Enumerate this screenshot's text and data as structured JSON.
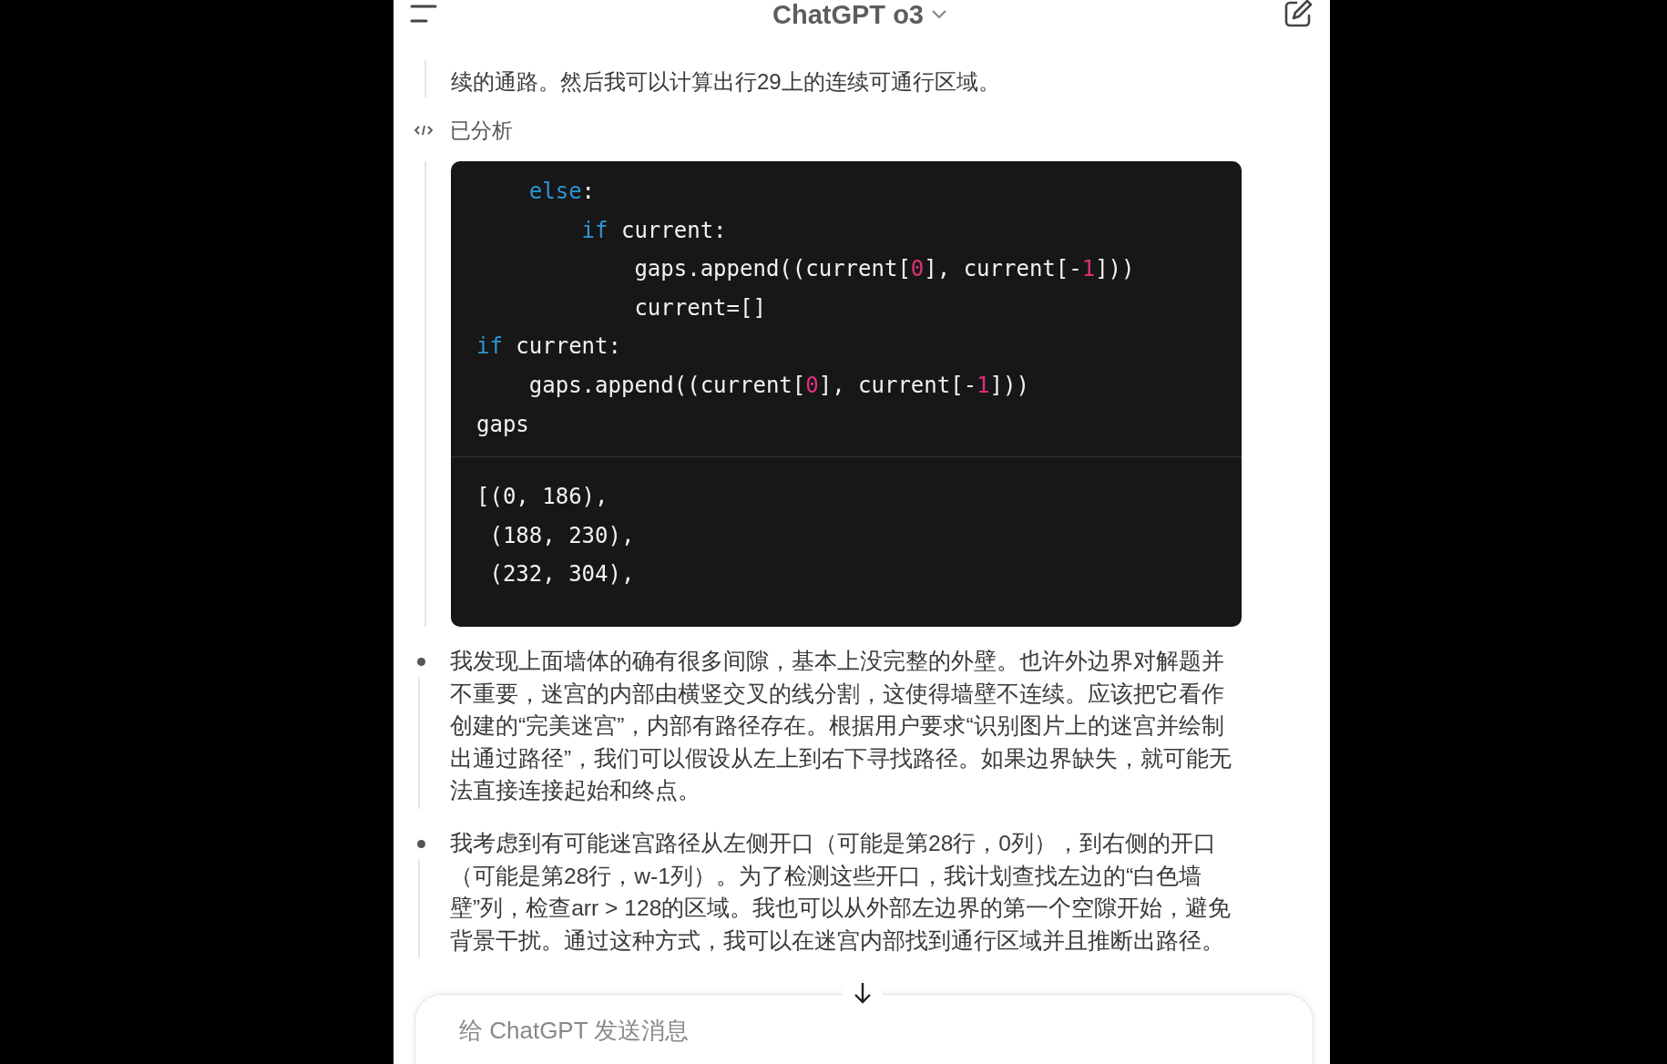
{
  "header": {
    "title": "ChatGPT o3"
  },
  "intro": {
    "lines": [
      "续的通路。然后我可以计算出行29上的连续可通行区域。"
    ]
  },
  "analysis": {
    "label": "已分析",
    "code": [
      [
        {
          "kind": "keyword",
          "text": "    else"
        },
        {
          "kind": "plain",
          "text": ":"
        }
      ],
      [
        {
          "kind": "keyword",
          "text": "        if"
        },
        {
          "kind": "plain",
          "text": " current:"
        }
      ],
      [
        {
          "kind": "plain",
          "text": "            gaps.append((current["
        },
        {
          "kind": "number",
          "text": "0"
        },
        {
          "kind": "plain",
          "text": "], current[-"
        },
        {
          "kind": "number",
          "text": "1"
        },
        {
          "kind": "plain",
          "text": "]))"
        }
      ],
      [
        {
          "kind": "plain",
          "text": "            current=[]"
        }
      ],
      [
        {
          "kind": "keyword",
          "text": "if"
        },
        {
          "kind": "plain",
          "text": " current:"
        }
      ],
      [
        {
          "kind": "plain",
          "text": "    gaps.append((current["
        },
        {
          "kind": "number",
          "text": "0"
        },
        {
          "kind": "plain",
          "text": "], current[-"
        },
        {
          "kind": "number",
          "text": "1"
        },
        {
          "kind": "plain",
          "text": "]))"
        }
      ],
      [
        {
          "kind": "plain",
          "text": "gaps"
        }
      ]
    ],
    "output": [
      "[(0, 186),",
      " (188, 230),",
      " (232, 304),"
    ]
  },
  "bullets": [
    "我发现上面墙体的确有很多间隙，基本上没完整的外壁。也许外边界对解题并不重要，迷宫的内部由横竖交叉的线分割，这使得墙壁不连续。应该把它看作创建的“完美迷宫”，内部有路径存在。根据用户要求“识别图片上的迷宫并绘制出通过路径”，我们可以假设从左上到右下寻找路径。如果边界缺失，就可能无法直接连接起始和终点。",
    "我考虑到有可能迷宫路径从左侧开口（可能是第28行，0列），到右侧的开口（可能是第28行，w-1列）。为了检测这些开口，我计划查找左边的“白色墙壁”列，检查arr > 128的区域。我也可以从外部左边界的第一个空隙开始，避免背景干扰。通过这种方式，我可以在迷宫内部找到通行区域并且推断出路径。"
  ],
  "composer": {
    "placeholder": "给 ChatGPT 发送消息"
  }
}
